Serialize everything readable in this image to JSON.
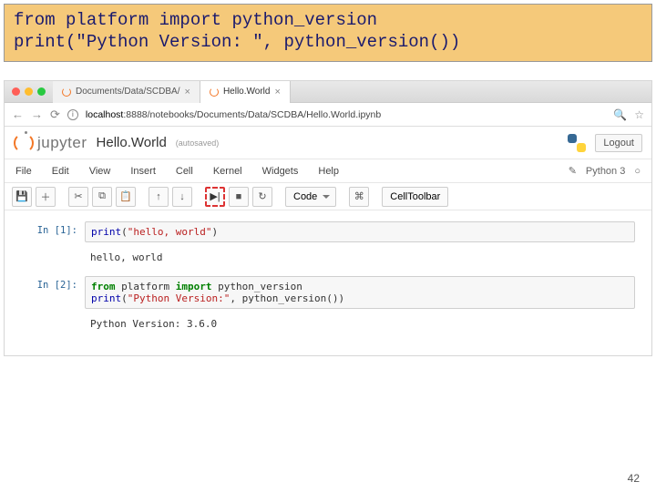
{
  "hero": {
    "line1": "from platform import python_version",
    "line2": "print(\"Python Version: \", python_version())"
  },
  "browser": {
    "tab1": "Documents/Data/SCDBA/",
    "tab2": "Hello.World",
    "url_host": "localhost",
    "url_path": ":8888/notebooks/Documents/Data/SCDBA/Hello.World.ipynb"
  },
  "jupyter": {
    "brand": "jupyter",
    "docname": "Hello.World",
    "autosave": "(autosaved)",
    "logout": "Logout",
    "kernel": "Python 3"
  },
  "menus": [
    "File",
    "Edit",
    "View",
    "Insert",
    "Cell",
    "Kernel",
    "Widgets",
    "Help"
  ],
  "toolbar": {
    "celltype": "Code",
    "celltoolbar": "CellToolbar"
  },
  "cells": {
    "c1_prompt": "In [1]:",
    "c1_fn": "print",
    "c1_str": "\"hello, world\"",
    "c1_out": "hello, world",
    "c2_prompt": "In [2]:",
    "c2_kw_from": "from",
    "c2_mod": " platform ",
    "c2_kw_imp": "import",
    "c2_sym": " python_version",
    "c2_fn": "print",
    "c2_str": "\"Python Version:\"",
    "c2_arg": ", python_version())",
    "c2_out": "Python Version: 3.6.0"
  },
  "page": "42"
}
